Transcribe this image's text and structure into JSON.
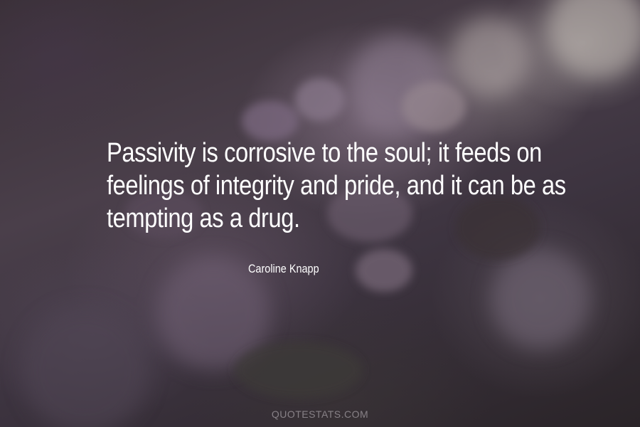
{
  "quote": {
    "lines": [
      "Passivity is corrosive to the soul; it feeds on",
      "feelings of integrity and pride, and it can be as",
      "tempting as a drug."
    ]
  },
  "author": "Caroline Knapp",
  "watermark": "QUOTESTATS.COM",
  "colors": {
    "text": "#ffffff",
    "background_dark": "#2d2630",
    "blossom_tint": "#8a7a8c"
  }
}
